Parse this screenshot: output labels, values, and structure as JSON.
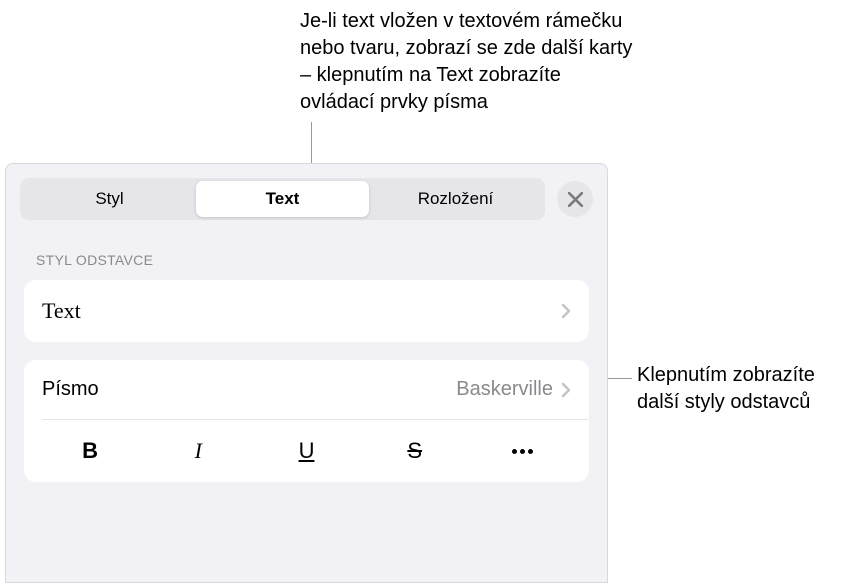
{
  "callouts": {
    "top": "Je-li text vložen v textovém rámečku nebo tvaru, zobrazí se zde další karty – klepnutím na Text zobrazíte ovládací prvky písma",
    "right": "Klepnutím zobrazíte další styly odstavců"
  },
  "tabs": {
    "style": "Styl",
    "text": "Text",
    "layout": "Rozložení"
  },
  "section": {
    "paragraphStyle": "STYL ODSTAVCE"
  },
  "paragraphStyle": {
    "value": "Text"
  },
  "font": {
    "label": "Písmo",
    "value": "Baskerville"
  },
  "format": {
    "bold": "B",
    "italic": "I",
    "underline": "U",
    "strike": "S"
  }
}
